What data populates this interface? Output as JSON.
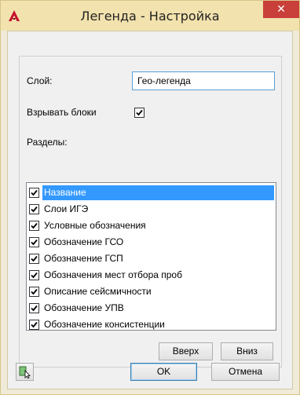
{
  "window": {
    "title": "Легенда - Настройка",
    "close_symbol": "✕"
  },
  "form": {
    "layer_label": "Слой:",
    "layer_value": "Гео-легенда",
    "explode_label": "Взрывать блоки",
    "explode_checked": true,
    "sections_label": "Разделы:"
  },
  "sections": [
    {
      "label": "Название",
      "checked": true,
      "selected": true
    },
    {
      "label": "Слои ИГЭ",
      "checked": true
    },
    {
      "label": "Условные обозначения",
      "checked": true
    },
    {
      "label": "Обозначение ГСО",
      "checked": true
    },
    {
      "label": "Обозначение ГСП",
      "checked": true
    },
    {
      "label": "Обозначения мест отбора проб",
      "checked": true
    },
    {
      "label": "Описание сейсмичности",
      "checked": true
    },
    {
      "label": "Обозначение УПВ",
      "checked": true
    },
    {
      "label": "Обозначение консистенции",
      "checked": true
    }
  ],
  "buttons": {
    "up": "Вверх",
    "down": "Вниз",
    "ok": "OK",
    "cancel": "Отмена"
  },
  "icons": {
    "app": "autocad-a-icon",
    "pick": "select-object-icon"
  },
  "colors": {
    "titlebar": "#f2e2ad",
    "close": "#c9403a",
    "selection": "#3399ff",
    "input_focus": "#5b9fd6"
  }
}
